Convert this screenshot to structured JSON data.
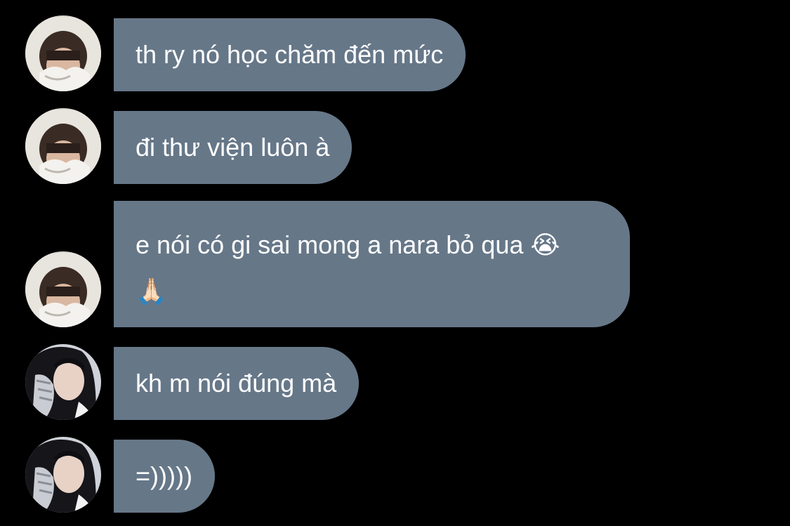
{
  "messages": [
    {
      "sender": "boy",
      "text": "th ry nó học chăm đến mức"
    },
    {
      "sender": "boy",
      "text": "đi thư viện luôn à"
    },
    {
      "sender": "boy",
      "line1": "e nói có gi sai mong a nara bỏ qua 😭",
      "line2": "🙏🏻"
    },
    {
      "sender": "girl",
      "text": "kh m nói đúng mà"
    },
    {
      "sender": "girl",
      "text": "=)))))"
    }
  ],
  "colors": {
    "background": "#000000",
    "bubble": "#667788",
    "text": "#ffffff"
  }
}
